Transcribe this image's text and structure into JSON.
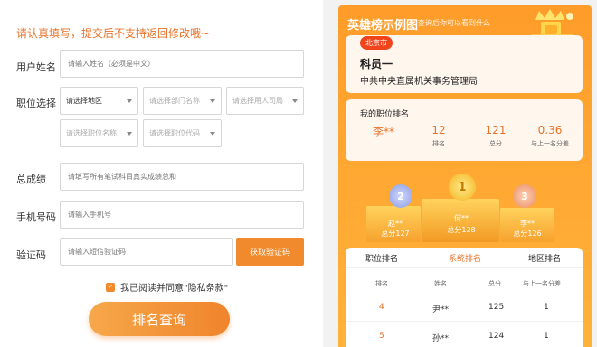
{
  "form": {
    "notice": "请认真填写，提交后不支持返回修改哦~",
    "name_label": "用户姓名",
    "name_placeholder": "请输入姓名（必须是中文）",
    "job_label": "职位选择",
    "region_select": "请选择地区",
    "dept_select": "请选择部门名称",
    "employer_select": "请选择用人司局",
    "position_select": "请选择职位名称",
    "code_select": "请选择职位代码",
    "score_label": "总成绩",
    "score_placeholder": "请填写所有笔试科目真实成绩总和",
    "phone_label": "手机号码",
    "phone_placeholder": "请输入手机号",
    "verify_label": "验证码",
    "verify_placeholder": "请输入短信验证码",
    "get_code_button": "获取验证码",
    "agree_text": "我已阅读并同意\"隐私条款\"",
    "submit_button": "排名查询"
  },
  "panel": {
    "title": "英雄榜示例图",
    "subtitle": "查询后你可以看到什么",
    "city": "北京市",
    "person": "科员一",
    "org": "中共中央直属机关事务管理局",
    "my_rank_title": "我的职位排名",
    "stats": [
      {
        "value": "李**",
        "key": ""
      },
      {
        "value": "12",
        "key": "排名"
      },
      {
        "value": "121",
        "key": "总分"
      },
      {
        "value": "0.36",
        "key": "与上一名分差"
      }
    ],
    "podium": [
      {
        "medal": "2",
        "name": "赵**",
        "score": "总分127"
      },
      {
        "medal": "1",
        "name": "何**",
        "score": "总分128"
      },
      {
        "medal": "3",
        "name": "李**",
        "score": "总分126"
      }
    ],
    "tabs": [
      "职位排名",
      "系统排名",
      "地区排名"
    ],
    "headers": [
      "排名",
      "姓名",
      "总分",
      "与上一名分差"
    ],
    "rows": [
      {
        "rank": "4",
        "name": "尹**",
        "score": "125",
        "diff": "1"
      },
      {
        "rank": "5",
        "name": "孙**",
        "score": "124",
        "diff": "1"
      }
    ],
    "colors": {
      "accent": "#f08a2c",
      "panel": "#ffa631",
      "badge": "#f0441d"
    }
  }
}
